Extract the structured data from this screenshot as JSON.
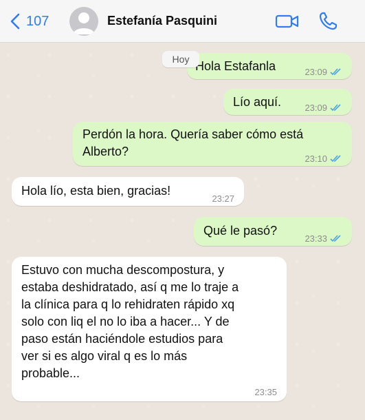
{
  "header": {
    "back_count": "107",
    "contact_name": "Estefanía Pasquini",
    "accent_color": "#2f7cf6",
    "icons": [
      "chevron-left-icon",
      "avatar-placeholder-icon",
      "video-camera-icon",
      "phone-icon"
    ]
  },
  "chat": {
    "date_chip": "Hoy",
    "messages": [
      {
        "direction": "outgoing",
        "text": "Hola Estafanla",
        "time": "23:09",
        "status": "read"
      },
      {
        "direction": "outgoing",
        "text": "Lío aquí.",
        "time": "23:09",
        "status": "read"
      },
      {
        "direction": "outgoing",
        "lines": [
          "Perdón la hora. Quería saber cómo está",
          "Alberto?"
        ],
        "time": "23:10",
        "status": "read"
      },
      {
        "direction": "incoming",
        "text": "Hola lío, esta bien, gracias!",
        "time": "23:27"
      },
      {
        "direction": "outgoing",
        "text": "Qué le pasó?",
        "time": "23:33",
        "status": "read"
      },
      {
        "direction": "incoming",
        "lines": [
          "Estuvo con mucha descompostura, y",
          "estaba deshidratado, así q me lo traje a",
          "la clínica para q lo rehidraten rápido xq",
          "solo con liq el no lo iba a hacer... Y de",
          "paso están haciéndole estudios para",
          "ver si es algo viral q es lo más",
          "probable..."
        ],
        "time": "23:35"
      }
    ],
    "colors": {
      "outgoing_bubble": "#dcf8c6",
      "incoming_bubble": "#ffffff",
      "read_ticks": "#4fa3e0"
    }
  }
}
